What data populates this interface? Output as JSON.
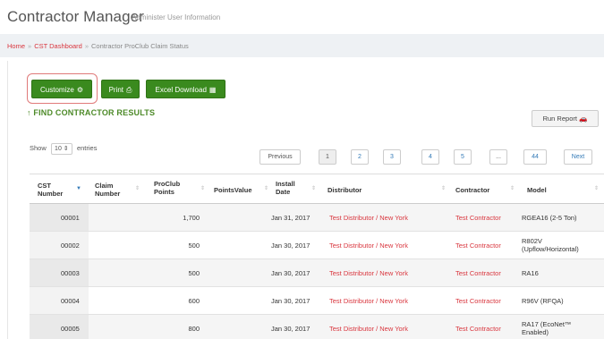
{
  "header": {
    "title": "Contractor Manager",
    "subtitle": "Administer User Information"
  },
  "breadcrumb": {
    "home": "Home",
    "dashboard": "CST Dashboard",
    "current": "Contractor ProClub Claim Status"
  },
  "toolbar": {
    "customize_label": "Customize",
    "print_label": "Print",
    "excel_label": "Excel Download"
  },
  "find_results_label": "FIND CONTRACTOR RESULTS",
  "run_report_label": "Run Report",
  "length": {
    "show_label": "Show",
    "value": "10",
    "entries_label": "entries"
  },
  "pagination": {
    "previous": "Previous",
    "pages": [
      "1",
      "2",
      "3",
      "4",
      "5",
      "...",
      "44"
    ],
    "next": "Next",
    "active_page": "1"
  },
  "table": {
    "columns": [
      "CST Number",
      "Claim Number",
      "ProClub Points",
      "PointsValue",
      "Install Date",
      "Distributor",
      "Contractor",
      "Model"
    ],
    "rows": [
      {
        "cst": "00001",
        "claim": "",
        "points": "1,700",
        "value": "",
        "date": "Jan 31, 2017",
        "distributor": "Test Distributor / New York",
        "contractor": "Test Contractor",
        "model": "RGEA16 (2-5 Ton)"
      },
      {
        "cst": "00002",
        "claim": "",
        "points": "500",
        "value": "",
        "date": "Jan 30, 2017",
        "distributor": "Test Distributor / New York",
        "contractor": "Test Contractor",
        "model": "R802V (Upflow/Horizontal)"
      },
      {
        "cst": "00003",
        "claim": "",
        "points": "500",
        "value": "",
        "date": "Jan 30, 2017",
        "distributor": "Test Distributor / New York",
        "contractor": "Test Contractor",
        "model": "RA16"
      },
      {
        "cst": "00004",
        "claim": "",
        "points": "600",
        "value": "",
        "date": "Jan 30, 2017",
        "distributor": "Test Distributor / New York",
        "contractor": "Test Contractor",
        "model": "R96V (RFQA)"
      },
      {
        "cst": "00005",
        "claim": "",
        "points": "800",
        "value": "",
        "date": "Jan 30, 2017",
        "distributor": "Test Distributor / New York",
        "contractor": "Test Contractor",
        "model": "RA17 (EcoNet™ Enabled)"
      }
    ]
  },
  "icons": {
    "customize": "gear-icon",
    "print": "printer-icon",
    "excel": "spreadsheet-icon",
    "find": "arrow-up-icon",
    "run_report": "car-icon"
  },
  "colors": {
    "button_green": "#3a8a1e",
    "link_red": "#d9363e",
    "find_green": "#4d8a28",
    "outline_red": "#e07a7a"
  }
}
